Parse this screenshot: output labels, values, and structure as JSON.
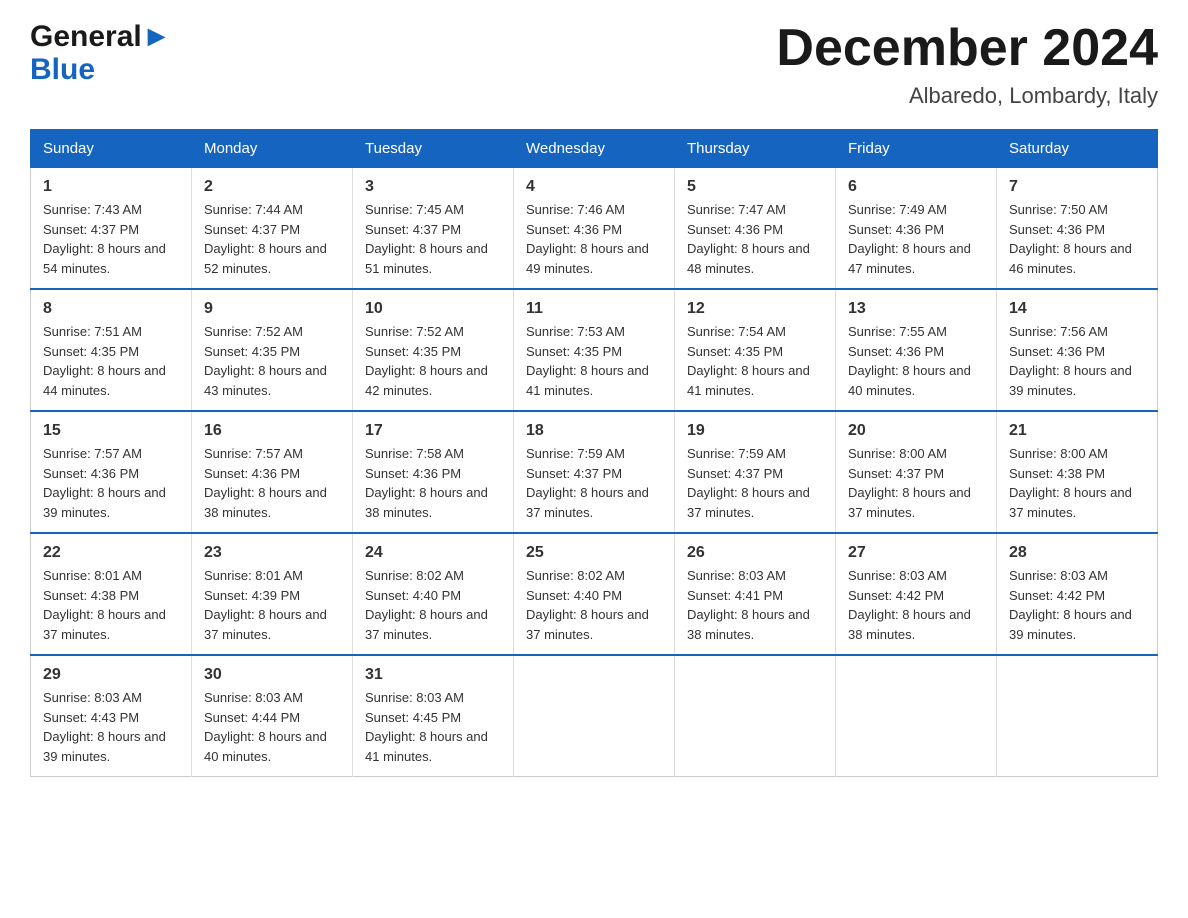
{
  "header": {
    "logo_general": "General",
    "logo_blue": "Blue",
    "month_title": "December 2024",
    "location": "Albaredo, Lombardy, Italy"
  },
  "days_of_week": [
    "Sunday",
    "Monday",
    "Tuesday",
    "Wednesday",
    "Thursday",
    "Friday",
    "Saturday"
  ],
  "weeks": [
    [
      {
        "day": "1",
        "sunrise": "Sunrise: 7:43 AM",
        "sunset": "Sunset: 4:37 PM",
        "daylight": "Daylight: 8 hours and 54 minutes."
      },
      {
        "day": "2",
        "sunrise": "Sunrise: 7:44 AM",
        "sunset": "Sunset: 4:37 PM",
        "daylight": "Daylight: 8 hours and 52 minutes."
      },
      {
        "day": "3",
        "sunrise": "Sunrise: 7:45 AM",
        "sunset": "Sunset: 4:37 PM",
        "daylight": "Daylight: 8 hours and 51 minutes."
      },
      {
        "day": "4",
        "sunrise": "Sunrise: 7:46 AM",
        "sunset": "Sunset: 4:36 PM",
        "daylight": "Daylight: 8 hours and 49 minutes."
      },
      {
        "day": "5",
        "sunrise": "Sunrise: 7:47 AM",
        "sunset": "Sunset: 4:36 PM",
        "daylight": "Daylight: 8 hours and 48 minutes."
      },
      {
        "day": "6",
        "sunrise": "Sunrise: 7:49 AM",
        "sunset": "Sunset: 4:36 PM",
        "daylight": "Daylight: 8 hours and 47 minutes."
      },
      {
        "day": "7",
        "sunrise": "Sunrise: 7:50 AM",
        "sunset": "Sunset: 4:36 PM",
        "daylight": "Daylight: 8 hours and 46 minutes."
      }
    ],
    [
      {
        "day": "8",
        "sunrise": "Sunrise: 7:51 AM",
        "sunset": "Sunset: 4:35 PM",
        "daylight": "Daylight: 8 hours and 44 minutes."
      },
      {
        "day": "9",
        "sunrise": "Sunrise: 7:52 AM",
        "sunset": "Sunset: 4:35 PM",
        "daylight": "Daylight: 8 hours and 43 minutes."
      },
      {
        "day": "10",
        "sunrise": "Sunrise: 7:52 AM",
        "sunset": "Sunset: 4:35 PM",
        "daylight": "Daylight: 8 hours and 42 minutes."
      },
      {
        "day": "11",
        "sunrise": "Sunrise: 7:53 AM",
        "sunset": "Sunset: 4:35 PM",
        "daylight": "Daylight: 8 hours and 41 minutes."
      },
      {
        "day": "12",
        "sunrise": "Sunrise: 7:54 AM",
        "sunset": "Sunset: 4:35 PM",
        "daylight": "Daylight: 8 hours and 41 minutes."
      },
      {
        "day": "13",
        "sunrise": "Sunrise: 7:55 AM",
        "sunset": "Sunset: 4:36 PM",
        "daylight": "Daylight: 8 hours and 40 minutes."
      },
      {
        "day": "14",
        "sunrise": "Sunrise: 7:56 AM",
        "sunset": "Sunset: 4:36 PM",
        "daylight": "Daylight: 8 hours and 39 minutes."
      }
    ],
    [
      {
        "day": "15",
        "sunrise": "Sunrise: 7:57 AM",
        "sunset": "Sunset: 4:36 PM",
        "daylight": "Daylight: 8 hours and 39 minutes."
      },
      {
        "day": "16",
        "sunrise": "Sunrise: 7:57 AM",
        "sunset": "Sunset: 4:36 PM",
        "daylight": "Daylight: 8 hours and 38 minutes."
      },
      {
        "day": "17",
        "sunrise": "Sunrise: 7:58 AM",
        "sunset": "Sunset: 4:36 PM",
        "daylight": "Daylight: 8 hours and 38 minutes."
      },
      {
        "day": "18",
        "sunrise": "Sunrise: 7:59 AM",
        "sunset": "Sunset: 4:37 PM",
        "daylight": "Daylight: 8 hours and 37 minutes."
      },
      {
        "day": "19",
        "sunrise": "Sunrise: 7:59 AM",
        "sunset": "Sunset: 4:37 PM",
        "daylight": "Daylight: 8 hours and 37 minutes."
      },
      {
        "day": "20",
        "sunrise": "Sunrise: 8:00 AM",
        "sunset": "Sunset: 4:37 PM",
        "daylight": "Daylight: 8 hours and 37 minutes."
      },
      {
        "day": "21",
        "sunrise": "Sunrise: 8:00 AM",
        "sunset": "Sunset: 4:38 PM",
        "daylight": "Daylight: 8 hours and 37 minutes."
      }
    ],
    [
      {
        "day": "22",
        "sunrise": "Sunrise: 8:01 AM",
        "sunset": "Sunset: 4:38 PM",
        "daylight": "Daylight: 8 hours and 37 minutes."
      },
      {
        "day": "23",
        "sunrise": "Sunrise: 8:01 AM",
        "sunset": "Sunset: 4:39 PM",
        "daylight": "Daylight: 8 hours and 37 minutes."
      },
      {
        "day": "24",
        "sunrise": "Sunrise: 8:02 AM",
        "sunset": "Sunset: 4:40 PM",
        "daylight": "Daylight: 8 hours and 37 minutes."
      },
      {
        "day": "25",
        "sunrise": "Sunrise: 8:02 AM",
        "sunset": "Sunset: 4:40 PM",
        "daylight": "Daylight: 8 hours and 37 minutes."
      },
      {
        "day": "26",
        "sunrise": "Sunrise: 8:03 AM",
        "sunset": "Sunset: 4:41 PM",
        "daylight": "Daylight: 8 hours and 38 minutes."
      },
      {
        "day": "27",
        "sunrise": "Sunrise: 8:03 AM",
        "sunset": "Sunset: 4:42 PM",
        "daylight": "Daylight: 8 hours and 38 minutes."
      },
      {
        "day": "28",
        "sunrise": "Sunrise: 8:03 AM",
        "sunset": "Sunset: 4:42 PM",
        "daylight": "Daylight: 8 hours and 39 minutes."
      }
    ],
    [
      {
        "day": "29",
        "sunrise": "Sunrise: 8:03 AM",
        "sunset": "Sunset: 4:43 PM",
        "daylight": "Daylight: 8 hours and 39 minutes."
      },
      {
        "day": "30",
        "sunrise": "Sunrise: 8:03 AM",
        "sunset": "Sunset: 4:44 PM",
        "daylight": "Daylight: 8 hours and 40 minutes."
      },
      {
        "day": "31",
        "sunrise": "Sunrise: 8:03 AM",
        "sunset": "Sunset: 4:45 PM",
        "daylight": "Daylight: 8 hours and 41 minutes."
      },
      null,
      null,
      null,
      null
    ]
  ]
}
